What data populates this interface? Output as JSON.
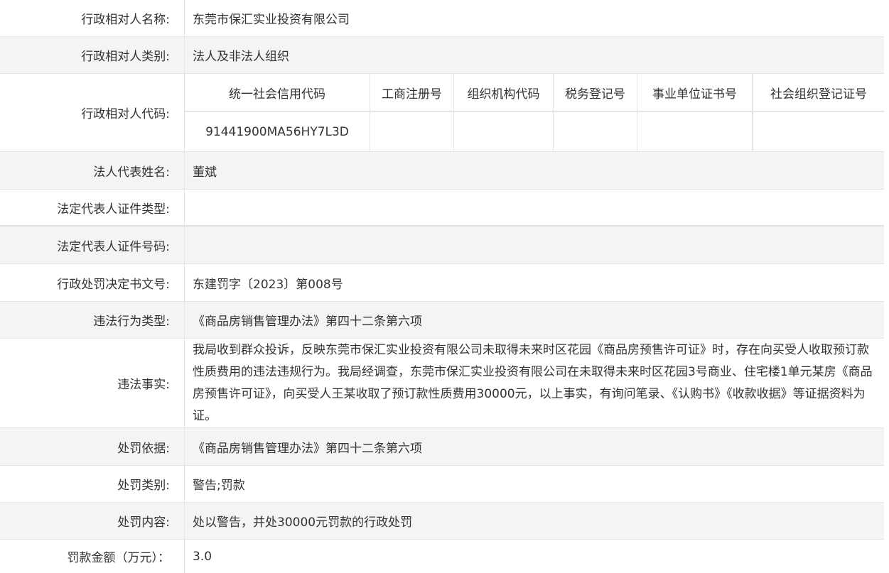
{
  "rows": {
    "name": {
      "label": "行政相对人名称:",
      "value": "东莞市保汇实业投资有限公司"
    },
    "category": {
      "label": "行政相对人类别:",
      "value": "法人及非法人组织"
    },
    "code": {
      "label": "行政相对人代码:"
    },
    "legal_rep": {
      "label": "法人代表姓名:",
      "value": "董斌"
    },
    "id_type": {
      "label": "法定代表人证件类型:",
      "value": ""
    },
    "id_number": {
      "label": "法定代表人证件号码:",
      "value": ""
    },
    "decision_no": {
      "label": "行政处罚决定书文号:",
      "value": "东建罚字〔2023〕第008号"
    },
    "violation_type": {
      "label": "违法行为类型:",
      "value": "《商品房销售管理办法》第四十二条第六项"
    },
    "facts": {
      "label": "违法事实:",
      "value": "我局收到群众投诉，反映东莞市保汇实业投资有限公司未取得未来时区花园《商品房预售许可证》时，存在向买受人收取预订款性质费用的违法违规行为。我局经调查，东莞市保汇实业投资有限公司在未取得未来时区花园3号商业、住宅楼1单元某房《商品房预售许可证》，向买受人王某收取了预订款性质费用30000元，以上事实，有询问笔录、《认购书》《收款收据》等证据资料为证。"
    },
    "basis": {
      "label": "处罚依据:",
      "value": "《商品房销售管理办法》第四十二条第六项"
    },
    "penalty_type": {
      "label": "处罚类别:",
      "value": "警告;罚款"
    },
    "penalty_content": {
      "label": "处罚内容:",
      "value": "处以警告，并处30000元罚款的行政处罚"
    },
    "fine_amount": {
      "label": "罚款金额（万元）：",
      "value": "3.0"
    }
  },
  "code_table": {
    "headers": [
      "统一社会信用代码",
      "工商注册号",
      "组织机构代码",
      "税务登记号",
      "事业单位证书号",
      "社会组织登记证号"
    ],
    "values": [
      "91441900MA56HY7L3D",
      "",
      "",
      "",
      "",
      ""
    ]
  }
}
